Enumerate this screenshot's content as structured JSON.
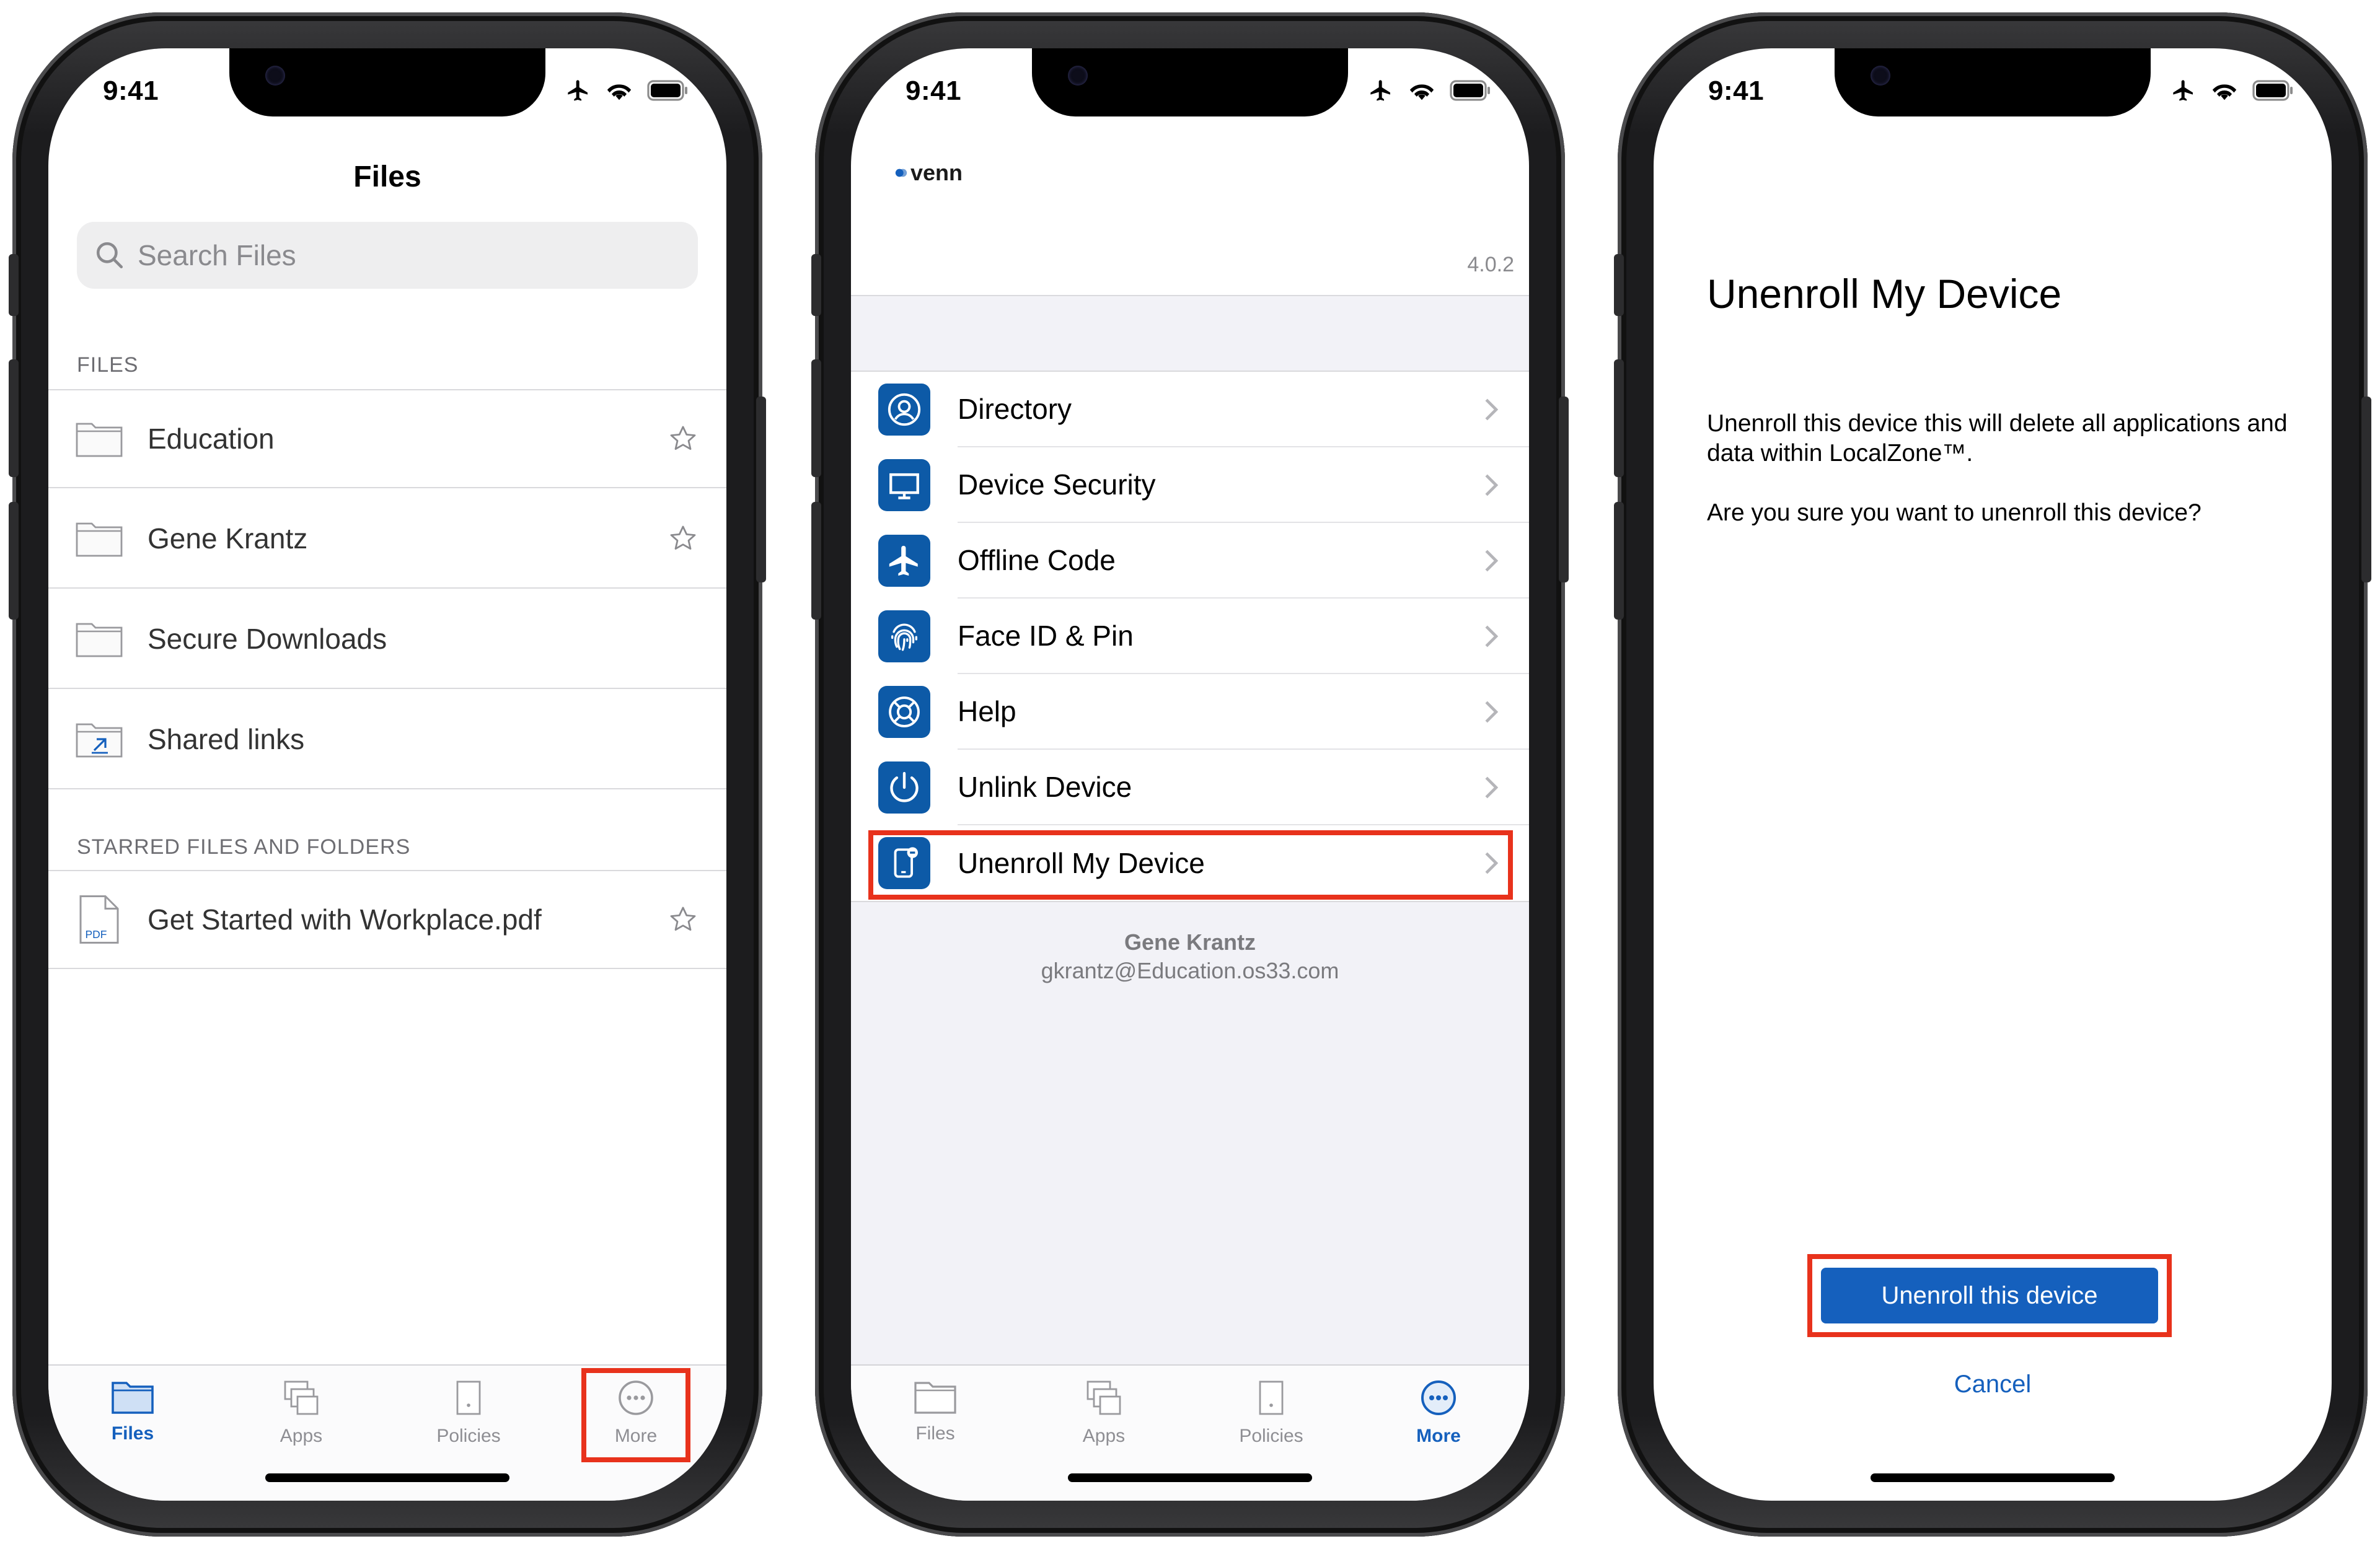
{
  "status": {
    "time": "9:41"
  },
  "files": {
    "title": "Files",
    "search_placeholder": "Search Files",
    "section_files": "FILES",
    "items": [
      {
        "label": "Education",
        "starred": true
      },
      {
        "label": "Gene Krantz",
        "starred": true
      },
      {
        "label": "Secure Downloads",
        "starred": false
      },
      {
        "label": "Shared links",
        "starred": false
      }
    ],
    "section_starred": "STARRED FILES AND FOLDERS",
    "starred_items": [
      {
        "label": "Get Started with Workplace.pdf",
        "badge": "PDF"
      }
    ]
  },
  "tabs": [
    {
      "label": "Files",
      "icon": "folder-icon"
    },
    {
      "label": "Apps",
      "icon": "apps-icon"
    },
    {
      "label": "Policies",
      "icon": "policies-icon"
    },
    {
      "label": "More",
      "icon": "more-icon"
    }
  ],
  "more": {
    "brand": "venn",
    "version": "4.0.2",
    "menu": [
      {
        "label": "Directory",
        "icon": "person-circle-icon"
      },
      {
        "label": "Device Security",
        "icon": "monitor-icon"
      },
      {
        "label": "Offline Code",
        "icon": "airplane-icon"
      },
      {
        "label": "Face ID & Pin",
        "icon": "fingerprint-icon"
      },
      {
        "label": "Help",
        "icon": "lifebuoy-icon"
      },
      {
        "label": "Unlink Device",
        "icon": "power-icon"
      },
      {
        "label": "Unenroll My Device",
        "icon": "phone-remove-icon"
      }
    ],
    "user_name": "Gene Krantz",
    "user_email": "gkrantz@Education.os33.com"
  },
  "unenroll": {
    "title": "Unenroll My Device",
    "body": "Unenroll this device this will delete all applications and data within LocalZone™.",
    "question": "Are you sure you want to unenroll this device?",
    "confirm_label": "Unenroll this device",
    "cancel_label": "Cancel"
  },
  "colors": {
    "accent": "#1560bd",
    "highlight": "#e8321c",
    "icon_tile": "#0d5aa7"
  }
}
